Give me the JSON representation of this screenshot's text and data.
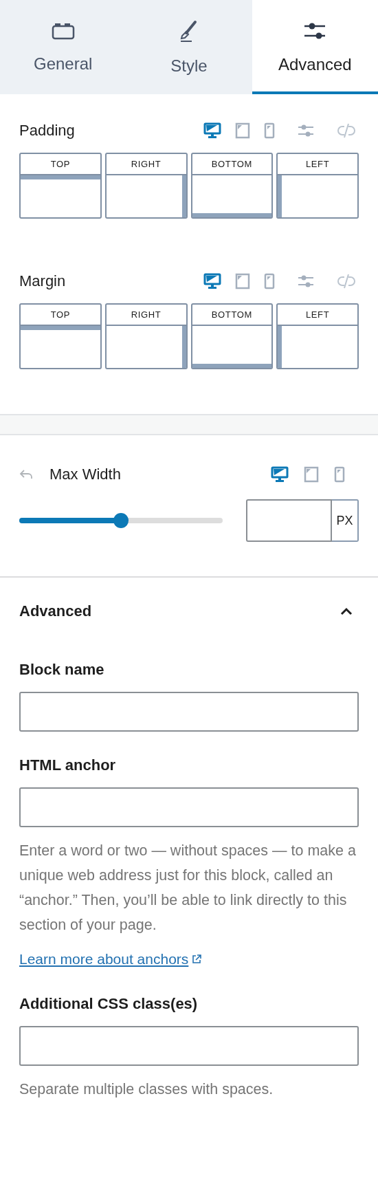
{
  "tabs": [
    {
      "label": "General",
      "selected": false
    },
    {
      "label": "Style",
      "selected": false
    },
    {
      "label": "Advanced",
      "selected": true
    }
  ],
  "spacing": [
    {
      "title": "Padding",
      "devices": [
        {
          "kind": "desktop",
          "selected": true
        },
        {
          "kind": "tablet",
          "selected": false
        },
        {
          "kind": "mobile",
          "selected": false
        }
      ],
      "sides": [
        {
          "label": "TOP"
        },
        {
          "label": "RIGHT"
        },
        {
          "label": "BOTTOM"
        },
        {
          "label": "LEFT"
        }
      ]
    },
    {
      "title": "Margin",
      "devices": [
        {
          "kind": "desktop",
          "selected": true
        },
        {
          "kind": "tablet",
          "selected": false
        },
        {
          "kind": "mobile",
          "selected": false
        }
      ],
      "sides": [
        {
          "label": "TOP"
        },
        {
          "label": "RIGHT"
        },
        {
          "label": "BOTTOM"
        },
        {
          "label": "LEFT"
        }
      ]
    }
  ],
  "max_width": {
    "title": "Max Width",
    "devices": [
      {
        "kind": "desktop",
        "selected": true
      },
      {
        "kind": "tablet",
        "selected": false
      },
      {
        "kind": "mobile",
        "selected": false
      }
    ],
    "level": 0.5,
    "unit": "PX"
  },
  "advanced": {
    "title": "Advanced",
    "expanded": true,
    "fields": [
      {
        "label": "Block name"
      },
      {
        "label": "HTML anchor",
        "help": "Enter a word or two — without spaces — to make a unique web address just for this block, called an “anchor.” Then, you’ll be able to link directly to this section of your page.",
        "link": "Learn more about anchors"
      },
      {
        "label": "Additional CSS class(es)",
        "help": "Separate multiple classes with spaces."
      }
    ]
  }
}
